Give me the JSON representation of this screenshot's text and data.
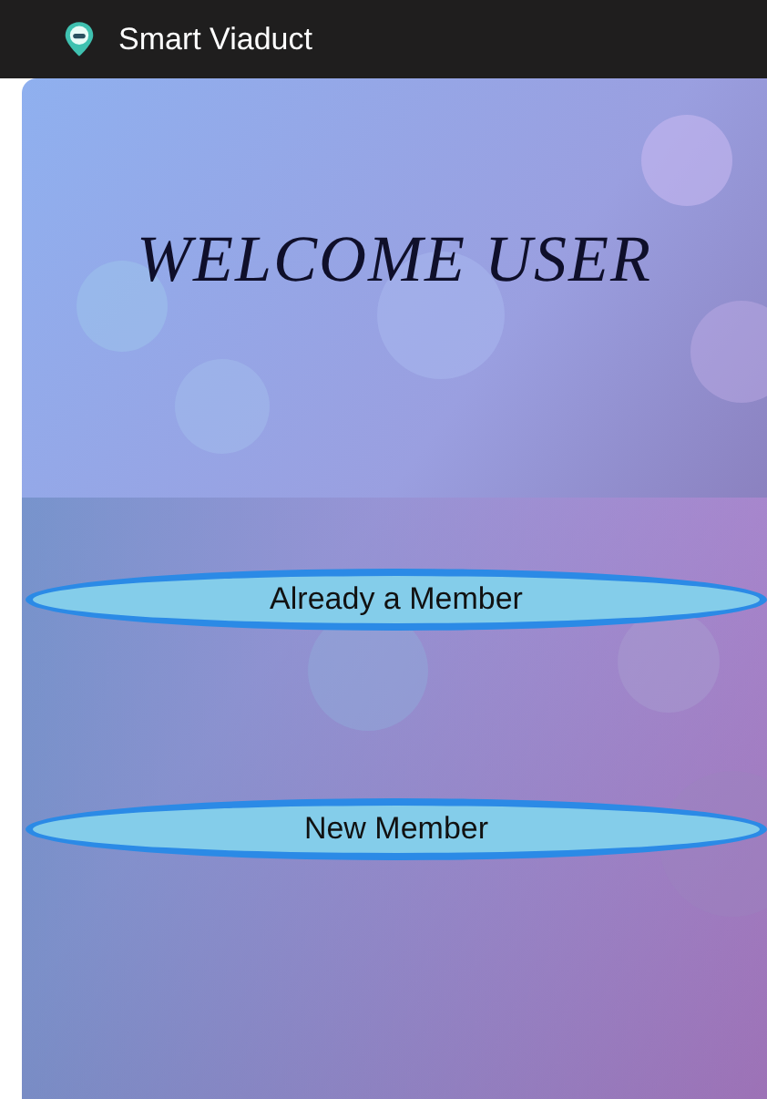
{
  "app_bar": {
    "title": "Smart Viaduct"
  },
  "screen": {
    "heading": "WELCOME USER",
    "buttons": [
      {
        "label": "Already a Member"
      },
      {
        "label": "New Member"
      }
    ]
  }
}
